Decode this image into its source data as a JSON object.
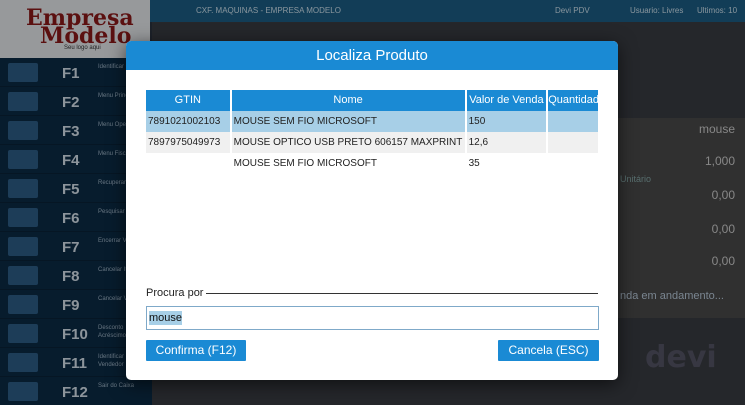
{
  "background": {
    "logo_line1": "Empresa",
    "logo_line2": "Modelo",
    "logo_tagline": "Seu logo aqui",
    "topbar_center": "CXF. MAQUINAS - EMPRESA MODELO",
    "topbar_app": "Devi PDV",
    "topbar_user": "Usuario: Livres",
    "topbar_date": "Ultimos: 10",
    "function_keys": [
      {
        "key": "F1",
        "label": "Identificar Cliente"
      },
      {
        "key": "F2",
        "label": "Menu Principal"
      },
      {
        "key": "F3",
        "label": "Menu Operações"
      },
      {
        "key": "F4",
        "label": "Menu Fiscal"
      },
      {
        "key": "F5",
        "label": "Recuperar Venda"
      },
      {
        "key": "F6",
        "label": "Pesquisar Produto"
      },
      {
        "key": "F7",
        "label": "Encerrar Venda"
      },
      {
        "key": "F8",
        "label": "Cancelar Item"
      },
      {
        "key": "F9",
        "label": "Cancelar Venda"
      },
      {
        "key": "F10",
        "label": "Desconto Acréscimo"
      },
      {
        "key": "F11",
        "label": "Identificar Vendedor"
      },
      {
        "key": "F12",
        "label": "Sair do Caixa"
      }
    ],
    "panel": {
      "search_value": "mouse",
      "quantity": "1,000",
      "unit_label": "Unitário",
      "unit_value": "0,00",
      "v2": "0,00",
      "v3": "0,00",
      "status": "nda em andamento...",
      "brand": "devi"
    }
  },
  "dialog": {
    "title": "Localiza Produto",
    "columns": [
      "GTIN",
      "Nome",
      "Valor de Venda",
      "Quantidade"
    ],
    "rows": [
      {
        "gtin": "7891021002103",
        "nome": "MOUSE SEM FIO MICROSOFT",
        "valor": "150",
        "qtd": ""
      },
      {
        "gtin": "7897975049973",
        "nome": "MOUSE OPTICO USB PRETO 606157 MAXPRINT",
        "valor": "12,6",
        "qtd": ""
      },
      {
        "gtin": "",
        "nome": "MOUSE SEM FIO MICROSOFT",
        "valor": "35",
        "qtd": ""
      }
    ],
    "search_label": "Procura por",
    "search_value": "mouse",
    "confirm_label": "Confirma (F12)",
    "cancel_label": "Cancela (ESC)",
    "accent": "#1a8ad4",
    "selection": "#a7cfe7"
  }
}
